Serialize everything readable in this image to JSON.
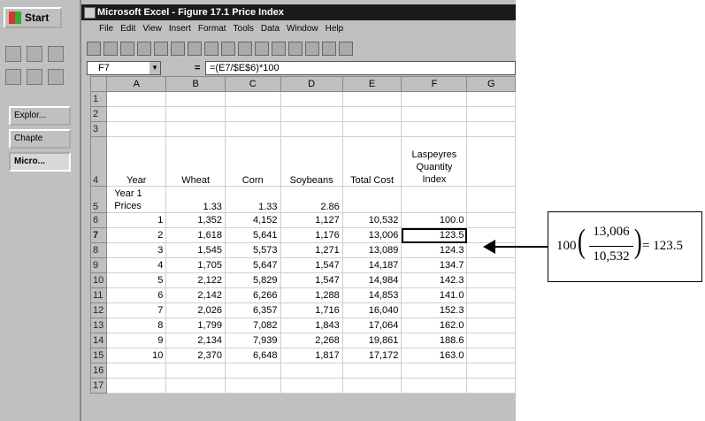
{
  "taskbar": {
    "start_label": "Start",
    "buttons": [
      "Explor...",
      "Chapte",
      "Micro..."
    ]
  },
  "window": {
    "title": "Microsoft Excel - Figure 17.1 Price Index",
    "menus": [
      "File",
      "Edit",
      "View",
      "Insert",
      "Format",
      "Tools",
      "Data",
      "Window",
      "Help"
    ]
  },
  "formula_bar": {
    "cell_ref": "F7",
    "equals": "=",
    "formula": "=(E7/$E$6)*100"
  },
  "columns": [
    "A",
    "B",
    "C",
    "D",
    "E",
    "F",
    "G"
  ],
  "row_numbers": [
    "1",
    "2",
    "3",
    "4",
    "5",
    "6",
    "7",
    "8",
    "9",
    "10",
    "11",
    "12",
    "13",
    "14",
    "15",
    "16",
    "17"
  ],
  "headers": {
    "year": "Year",
    "wheat": "Wheat",
    "corn": "Corn",
    "soybeans": "Soybeans",
    "total_cost": "Total Cost",
    "laspeyres_1": "Laspeyres",
    "laspeyres_2": "Quantity",
    "laspeyres_3": "Index"
  },
  "prices_row": {
    "label_1": "Year 1",
    "label_2": "Prices",
    "wheat": "1.33",
    "corn": "1.33",
    "soybeans": "2.86"
  },
  "data_rows": [
    {
      "year": "1",
      "wheat": "1,352",
      "corn": "4,152",
      "soybeans": "1,127",
      "total": "10,532",
      "index": "100.0"
    },
    {
      "year": "2",
      "wheat": "1,618",
      "corn": "5,641",
      "soybeans": "1,176",
      "total": "13,006",
      "index": "123.5"
    },
    {
      "year": "3",
      "wheat": "1,545",
      "corn": "5,573",
      "soybeans": "1,271",
      "total": "13,089",
      "index": "124.3"
    },
    {
      "year": "4",
      "wheat": "1,705",
      "corn": "5,647",
      "soybeans": "1,547",
      "total": "14,187",
      "index": "134.7"
    },
    {
      "year": "5",
      "wheat": "2,122",
      "corn": "5,829",
      "soybeans": "1,547",
      "total": "14,984",
      "index": "142.3"
    },
    {
      "year": "6",
      "wheat": "2,142",
      "corn": "6,266",
      "soybeans": "1,288",
      "total": "14,853",
      "index": "141.0"
    },
    {
      "year": "7",
      "wheat": "2,026",
      "corn": "6,357",
      "soybeans": "1,716",
      "total": "16,040",
      "index": "152.3"
    },
    {
      "year": "8",
      "wheat": "1,799",
      "corn": "7,082",
      "soybeans": "1,843",
      "total": "17,064",
      "index": "162.0"
    },
    {
      "year": "9",
      "wheat": "2,134",
      "corn": "7,939",
      "soybeans": "2,268",
      "total": "19,861",
      "index": "188.6"
    },
    {
      "year": "10",
      "wheat": "2,370",
      "corn": "6,648",
      "soybeans": "1,817",
      "total": "17,172",
      "index": "163.0"
    }
  ],
  "annotation": {
    "coef": "100",
    "numerator": "13,006",
    "denominator": "10,532",
    "result": "= 123.5"
  }
}
